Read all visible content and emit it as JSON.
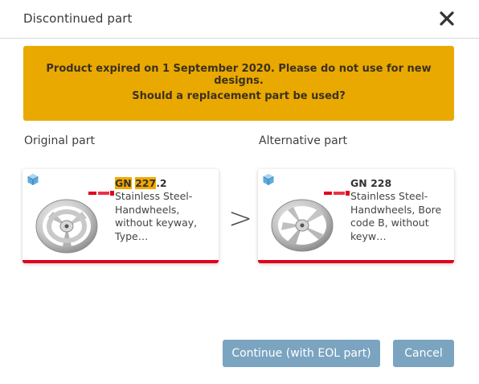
{
  "dialog": {
    "title": "Discontinued part"
  },
  "banner": {
    "message": "Product expired on 1 September 2020. Please do not use for new designs.",
    "question": "Should a replacement part be used?",
    "color": "#eaa900"
  },
  "original": {
    "label": "Original part",
    "title_prefix": "GN",
    "title_mid": "227",
    "title_suffix": ".2",
    "description": "Stainless Steel-Handwheels, without keyway, Type…",
    "icon": "cube-icon",
    "brand": "Ganter"
  },
  "separator": ">",
  "alternative": {
    "label": "Alternative part",
    "title": "GN 228",
    "description": "Stainless Steel-Handwheels, Bore code B, without keyw…",
    "icon": "cube-icon",
    "brand": "Ganter"
  },
  "buttons": {
    "continue_label": "Continue (with EOL part)",
    "cancel_label": "Cancel"
  },
  "colors": {
    "accent_red": "#e3001b",
    "highlight": "#f2a900",
    "button": "#7ba4c0"
  }
}
